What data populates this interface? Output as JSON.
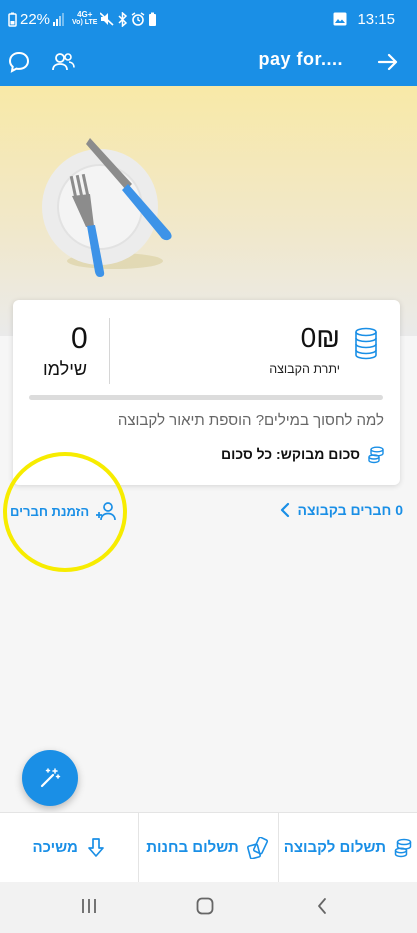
{
  "status_bar": {
    "battery": "22%",
    "network_top": "4G+",
    "network_bottom": "Vo) LTE",
    "time": "13:15"
  },
  "app_bar": {
    "title": "pay for....",
    "icons": [
      "chat-icon",
      "group-icon",
      "arrow-right-icon"
    ]
  },
  "card": {
    "balance_value": "0₪",
    "balance_label": "יתרת הקבוצה",
    "paid_value": "0",
    "paid_label": "שילמו",
    "progress_fraction": 0,
    "description_prompt": "למה לחסוך במילים? הוספת תיאור לקבוצה",
    "requested_amount": "סכום מבוקש: כל סכום"
  },
  "members": {
    "count_label": "0 חברים בקבוצה",
    "invite_label": "הזמנת חברים"
  },
  "bottom_actions": [
    {
      "label": "תשלום לקבוצה",
      "icon": "coins-icon"
    },
    {
      "label": "תשלום בחנות",
      "icon": "cards-icon"
    },
    {
      "label": "משיכה",
      "icon": "arrow-down-icon"
    }
  ],
  "colors": {
    "primary": "#1a8fe6",
    "banner": "#f8e9a7",
    "highlight": "#f7ec00"
  }
}
